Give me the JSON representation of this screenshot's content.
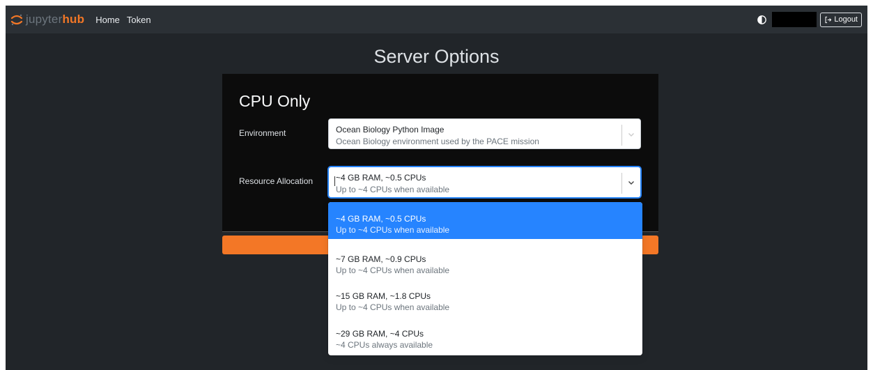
{
  "navbar": {
    "brand_part1": "jupyter",
    "brand_part2": "hub",
    "links": [
      "Home",
      "Token"
    ],
    "logout_label": "Logout",
    "icons": [
      "jupyter-logo-icon",
      "theme-toggle-icon",
      "logout-icon"
    ]
  },
  "page": {
    "title": "Server Options"
  },
  "profile": {
    "title": "CPU Only",
    "environment": {
      "label": "Environment",
      "value_title": "Ocean Biology Python Image",
      "value_desc": "Ocean Biology environment used by the PACE mission"
    },
    "resource": {
      "label": "Resource Allocation",
      "value_title": "~4 GB RAM, ~0.5 CPUs",
      "value_desc": "Up to ~4 CPUs when available"
    }
  },
  "resource_options": [
    {
      "title": "~4 GB RAM, ~0.5 CPUs",
      "desc": "Up to ~4 CPUs when available"
    },
    {
      "title": "~7 GB RAM, ~0.9 CPUs",
      "desc": "Up to ~4 CPUs when available"
    },
    {
      "title": "~15 GB RAM, ~1.8 CPUs",
      "desc": "Up to ~4 CPUs when available"
    },
    {
      "title": "~29 GB RAM, ~4 CPUs",
      "desc": "~4 CPUs always available"
    }
  ],
  "colors": {
    "background": "#212529",
    "navbar": "#2b3035",
    "brand_orange": "#f37726",
    "selected_option": "#2684ff"
  }
}
